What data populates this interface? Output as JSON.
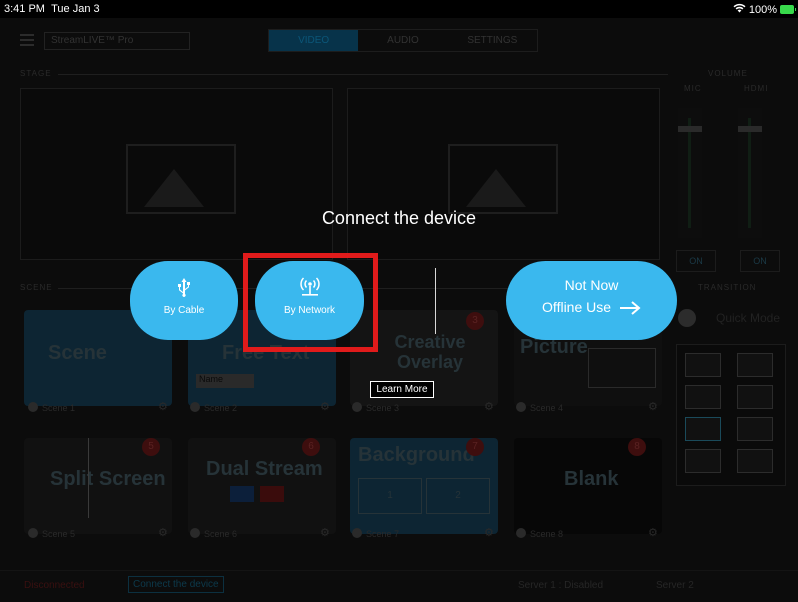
{
  "status_bar": {
    "time": "3:41 PM",
    "date": "Tue Jan 3",
    "battery": "100%",
    "wifi_icon": "wifi-icon",
    "battery_icon": "battery-charging-icon"
  },
  "app": {
    "profile": "StreamLIVE™ Pro",
    "tabs": [
      "VIDEO",
      "AUDIO",
      "SETTINGS"
    ],
    "sections": {
      "stage": "STAGE",
      "volume": "VOLUME",
      "scene": "SCENE",
      "transition": "TRANSITION"
    },
    "volume": {
      "mic_label": "MIC",
      "hdmi_label": "HDMI",
      "on_label": "ON"
    },
    "quick_mode": "Quick Mode",
    "scenes": [
      {
        "title": "Scene",
        "caption": "Scene 1",
        "badge": ""
      },
      {
        "title": "Free Text",
        "caption": "Scene 2",
        "badge": "",
        "sub": "Name"
      },
      {
        "title": "Creative Overlay",
        "caption": "Scene 3",
        "badge": "3"
      },
      {
        "title": "Picture",
        "caption": "Scene 4",
        "badge": ""
      },
      {
        "title": "Split Screen",
        "caption": "Scene 5",
        "badge": "5"
      },
      {
        "title": "Dual Stream",
        "caption": "Scene 6",
        "badge": "6"
      },
      {
        "title": "Background",
        "caption": "Scene 7",
        "badge": "7"
      },
      {
        "title": "Blank",
        "caption": "Scene 8",
        "badge": "8"
      }
    ],
    "background_sub": [
      "1",
      "2"
    ],
    "bottom": {
      "status": "Disconnected",
      "connect": "Connect the device",
      "server1": "Server 1 : Disabled",
      "server2": "Server 2"
    }
  },
  "dialog": {
    "title": "Connect the device",
    "by_cable": {
      "label": "By Cable",
      "icon": "usb-icon"
    },
    "by_network": {
      "label": "By Network",
      "icon": "network-antenna-icon"
    },
    "not_now": {
      "title": "Not Now",
      "subtitle": "Offline Use",
      "icon": "arrow-right-icon"
    },
    "learn_more": "Learn More"
  },
  "colors": {
    "accent": "#3ab8ee",
    "highlight": "#e01b1b",
    "background": "#000000"
  }
}
